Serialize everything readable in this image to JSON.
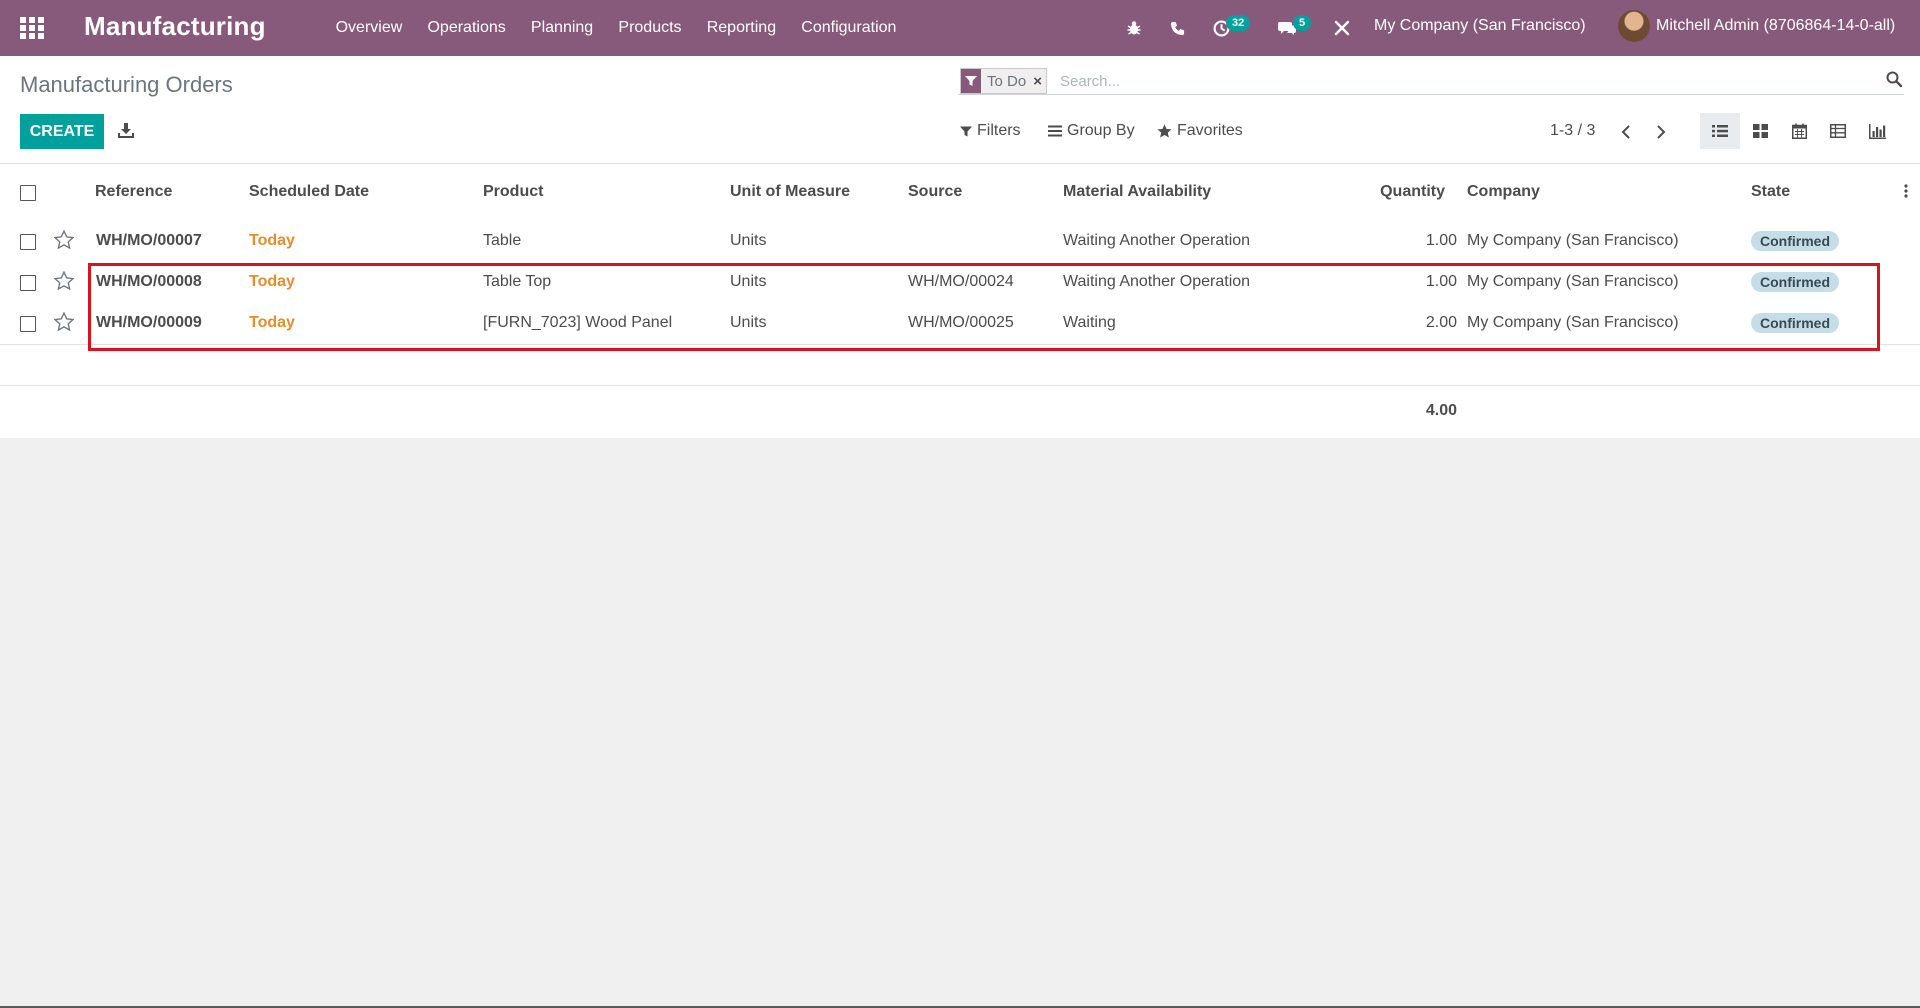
{
  "navbar": {
    "app_title": "Manufacturing",
    "menu": [
      "Overview",
      "Operations",
      "Planning",
      "Products",
      "Reporting",
      "Configuration"
    ],
    "activity_count": "32",
    "message_count": "5",
    "company": "My Company (San Francisco)",
    "user_name": "Mitchell Admin (8706864-14-0-all)"
  },
  "control_panel": {
    "breadcrumb": "Manufacturing Orders",
    "facet_label": "To Do",
    "search_placeholder": "Search...",
    "create_label": "CREATE",
    "filters_label": "Filters",
    "group_by_label": "Group By",
    "favorites_label": "Favorites",
    "pager": "1-3 / 3"
  },
  "table": {
    "headers": [
      "Reference",
      "Scheduled Date",
      "Product",
      "Unit of Measure",
      "Source",
      "Material Availability",
      "Quantity",
      "Company",
      "State"
    ],
    "rows": [
      {
        "reference": "WH/MO/00007",
        "date": "Today",
        "product": "Table",
        "uom": "Units",
        "source": "",
        "availability": "Waiting Another Operation",
        "quantity": "1.00",
        "company": "My Company (San Francisco)",
        "state": "Confirmed"
      },
      {
        "reference": "WH/MO/00008",
        "date": "Today",
        "product": "Table Top",
        "uom": "Units",
        "source": "WH/MO/00024",
        "availability": "Waiting Another Operation",
        "quantity": "1.00",
        "company": "My Company (San Francisco)",
        "state": "Confirmed"
      },
      {
        "reference": "WH/MO/00009",
        "date": "Today",
        "product": "[FURN_7023] Wood Panel",
        "uom": "Units",
        "source": "WH/MO/00025",
        "availability": "Waiting",
        "quantity": "2.00",
        "company": "My Company (San Francisco)",
        "state": "Confirmed"
      }
    ],
    "total_quantity": "4.00"
  },
  "colors": {
    "brand": "#875a7b",
    "primary_button": "#00a09d",
    "today": "#e38d2b",
    "state_badge": "#c4dde7",
    "highlight": "#d9141e"
  },
  "icons": [
    "apps-icon",
    "bug-icon",
    "phone-icon",
    "activity-icon",
    "chat-icon",
    "tools-icon",
    "filter-icon",
    "search-icon",
    "download-icon",
    "bars-icon",
    "star-icon",
    "chevron-left-icon",
    "chevron-right-icon",
    "list-view-icon",
    "kanban-view-icon",
    "calendar-view-icon",
    "pivot-view-icon",
    "graph-view-icon",
    "kebab-icon"
  ]
}
